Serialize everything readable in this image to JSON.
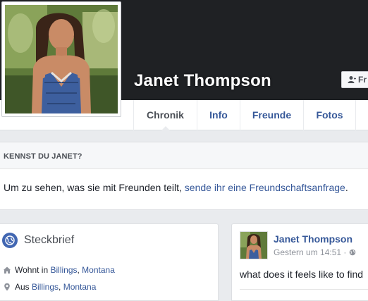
{
  "profile": {
    "name": "Janet Thompson",
    "friend_button_label": "Fr"
  },
  "tabs": [
    {
      "label": "Chronik",
      "active": true
    },
    {
      "label": "Info",
      "active": false
    },
    {
      "label": "Freunde",
      "active": false
    },
    {
      "label": "Fotos",
      "active": false
    }
  ],
  "know_card": {
    "heading": "KENNST DU JANET?",
    "text": "Um zu sehen, was sie mit Freunden teilt, ",
    "link": "sende ihr eine Freundschaftsanfrage",
    "suffix": "."
  },
  "intro": {
    "title": "Steckbrief",
    "lives_prefix": "Wohnt in ",
    "lives_city": "Billings",
    "lives_sep": ", ",
    "lives_state": "Montana",
    "from_prefix": "Aus ",
    "from_city": "Billings",
    "from_sep": ", ",
    "from_state": "Montana"
  },
  "post": {
    "author": "Janet Thompson",
    "time": "Gestern um 14:51 · ",
    "text": "what does it feels like to find"
  },
  "colors": {
    "cover": "#1f2124",
    "link": "#365899",
    "background": "#e9ebee",
    "accent": "#4267b2"
  }
}
